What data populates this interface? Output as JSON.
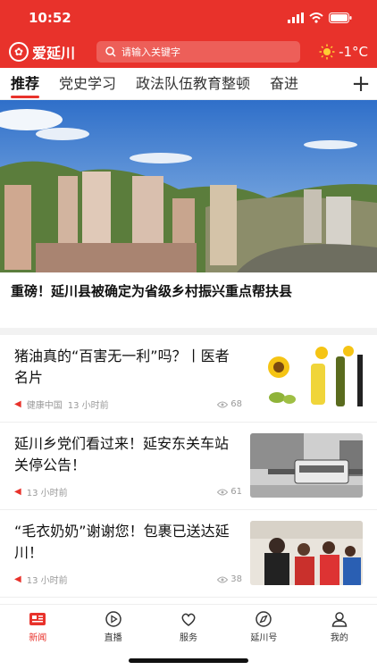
{
  "status": {
    "time": "10:52"
  },
  "header": {
    "logo_text": "爱延川",
    "search_placeholder": "请输入关键字",
    "weather": "-1°C",
    "weather_icon": "sun-icon"
  },
  "tabs": [
    {
      "label": "推荐",
      "active": true
    },
    {
      "label": "党史学习"
    },
    {
      "label": "政法队伍教育整顿"
    },
    {
      "label": "奋进"
    }
  ],
  "hero": {
    "title": "重磅！延川县被确定为省级乡村振兴重点帮扶县"
  },
  "news": [
    {
      "title": "猪油真的“百害无一利”吗？丨医者名片",
      "source": "健康中国",
      "time": "13 小时前",
      "views": "68",
      "thumb": "sunflower-oil"
    },
    {
      "title": "延川乡党们看过来！延安东关车站关停公告！",
      "source": "",
      "time": "13 小时前",
      "views": "61",
      "thumb": "bus-station"
    },
    {
      "title": "“毛衣奶奶”谢谢您！包裹已送达延川！",
      "source": "",
      "time": "13 小时前",
      "views": "38",
      "thumb": "children-gift"
    }
  ],
  "bottom_nav": [
    {
      "label": "新闻",
      "icon": "news-icon",
      "active": true
    },
    {
      "label": "直播",
      "icon": "play-icon"
    },
    {
      "label": "服务",
      "icon": "service-icon"
    },
    {
      "label": "延川号",
      "icon": "compass-icon"
    },
    {
      "label": "我的",
      "icon": "user-icon"
    }
  ],
  "colors": {
    "brand": "#e8322b"
  }
}
